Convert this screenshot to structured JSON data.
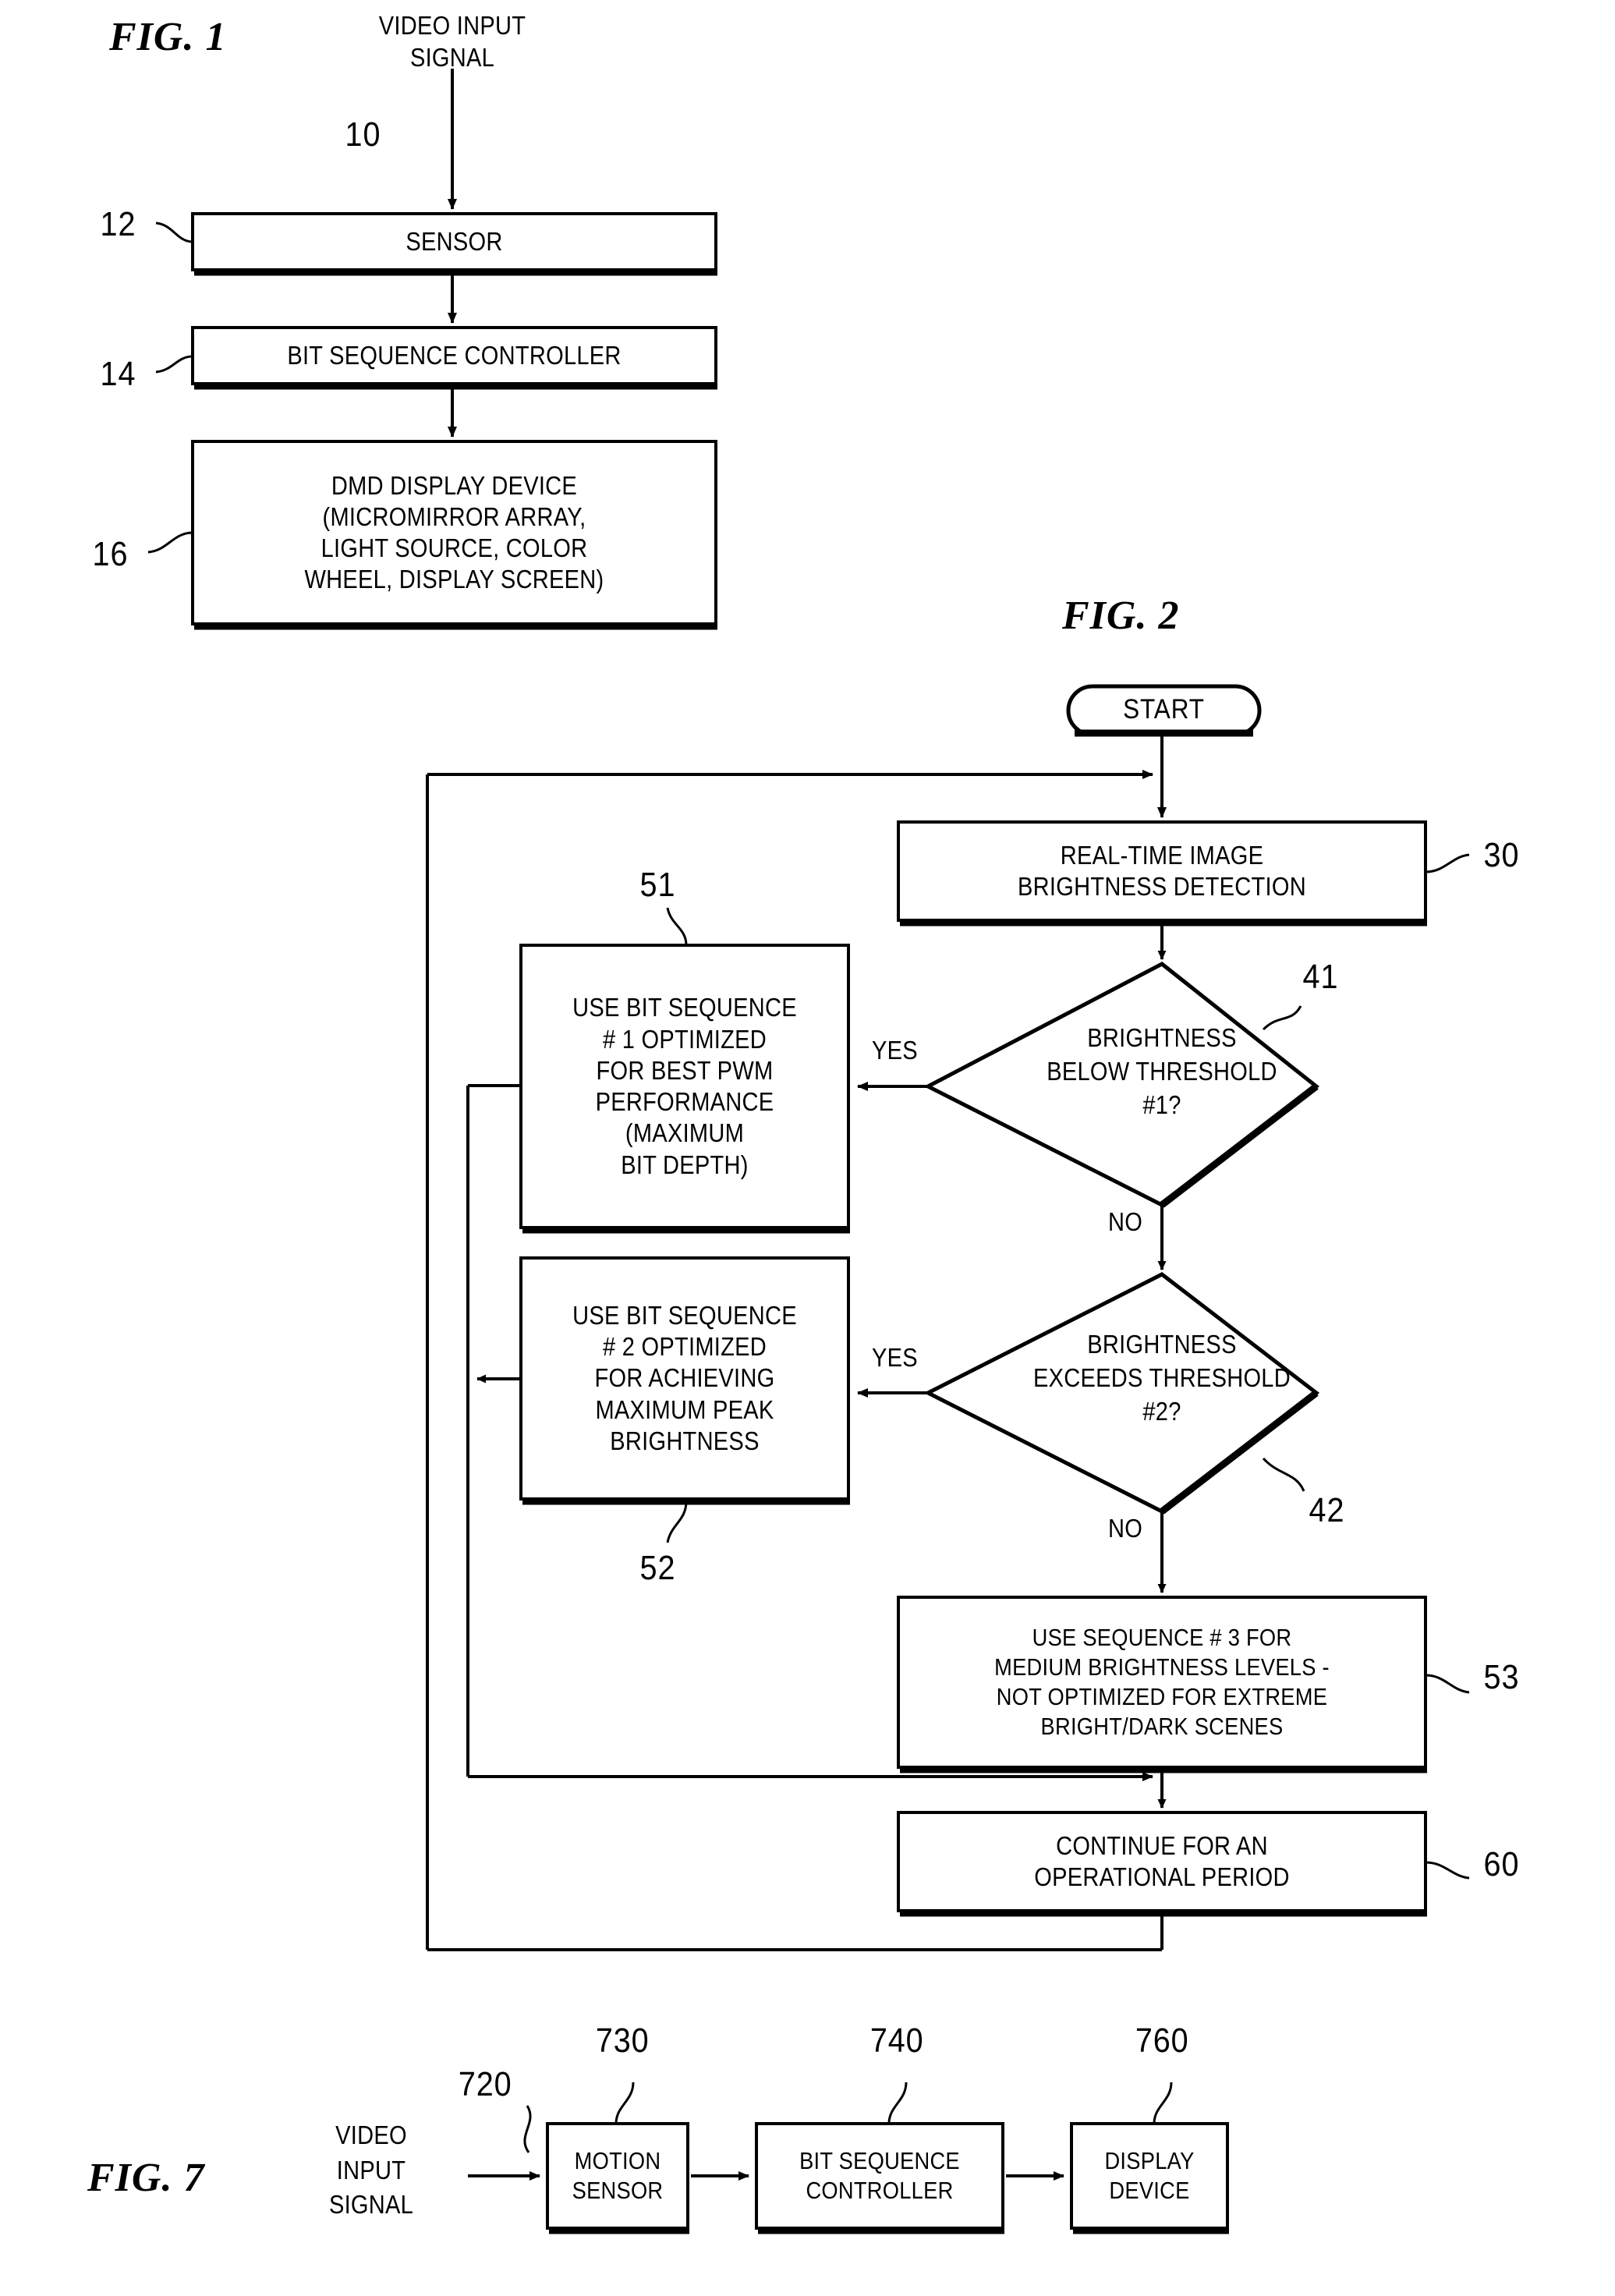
{
  "figures": {
    "fig1": {
      "label": "FIG. 1",
      "input_caption": "VIDEO INPUT\nSIGNAL",
      "refs": {
        "input": "10",
        "sensor": "12",
        "controller": "14",
        "display": "16"
      },
      "boxes": {
        "sensor": "SENSOR",
        "bit_sequence_controller": "BIT SEQUENCE CONTROLLER",
        "dmd_display_device": "DMD DISPLAY DEVICE\n(MICROMIRROR ARRAY,\nLIGHT SOURCE, COLOR\nWHEEL, DISPLAY SCREEN)"
      }
    },
    "fig2": {
      "label": "FIG. 2",
      "start": "START",
      "refs": {
        "detection": "30",
        "decision1": "41",
        "decision2": "42",
        "seq1": "51",
        "seq2": "52",
        "seq3": "53",
        "continue": "60"
      },
      "boxes": {
        "detection": "REAL-TIME IMAGE\nBRIGHTNESS DETECTION",
        "seq1": "USE BIT SEQUENCE\n# 1 OPTIMIZED\nFOR BEST PWM\nPERFORMANCE\n(MAXIMUM\nBIT DEPTH)",
        "seq2": "USE BIT SEQUENCE\n# 2 OPTIMIZED\nFOR ACHIEVING\nMAXIMUM PEAK\nBRIGHTNESS",
        "seq3": "USE SEQUENCE # 3 FOR\nMEDIUM BRIGHTNESS LEVELS -\nNOT OPTIMIZED FOR EXTREME\nBRIGHT/DARK SCENES",
        "continue": "CONTINUE FOR AN\nOPERATIONAL PERIOD"
      },
      "decisions": {
        "d1": "BRIGHTNESS\nBELOW THRESHOLD\n#1?",
        "d2": "BRIGHTNESS\nEXCEEDS THRESHOLD\n#2?"
      },
      "edges": {
        "d1_yes": "YES",
        "d1_no": "NO",
        "d2_yes": "YES",
        "d2_no": "NO"
      }
    },
    "fig7": {
      "label": "FIG. 7",
      "input_caption": "VIDEO\nINPUT\nSIGNAL",
      "refs": {
        "input": "720",
        "motion_sensor": "730",
        "controller": "740",
        "display": "760"
      },
      "boxes": {
        "motion_sensor": "MOTION\nSENSOR",
        "bit_sequence_controller": "BIT SEQUENCE\nCONTROLLER",
        "display_device": "DISPLAY\nDEVICE"
      }
    }
  },
  "colors": {
    "ink": "#000000",
    "paper": "#ffffff"
  }
}
